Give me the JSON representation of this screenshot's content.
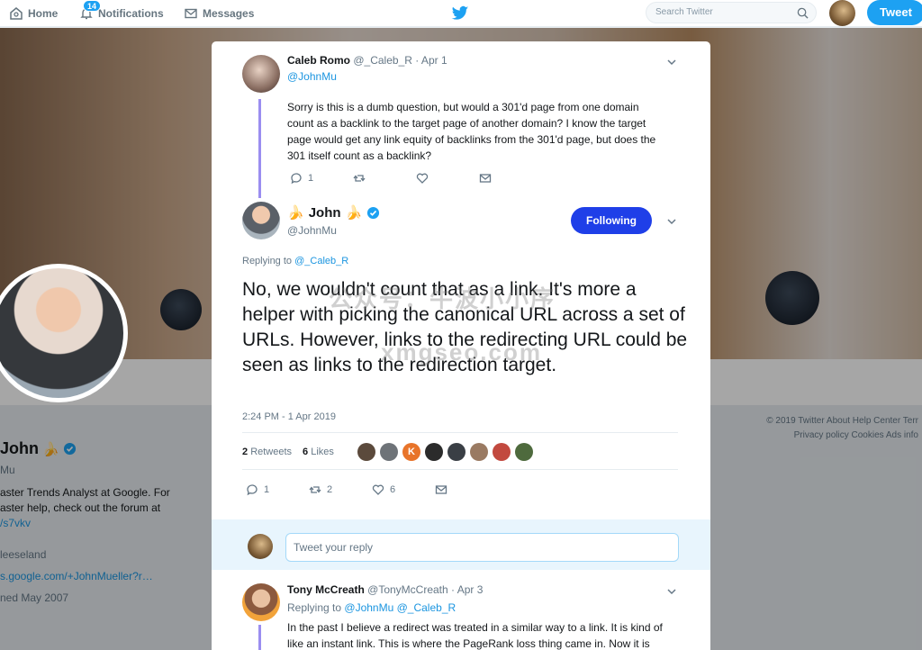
{
  "nav": {
    "home": "Home",
    "notifications": "Notifications",
    "notif_count": "14",
    "messages": "Messages",
    "search_placeholder": "Search Twitter",
    "tweet_button": "Tweet"
  },
  "profile": {
    "name": "John",
    "handle_partial": "Mu",
    "bio_line1": "aster Trends Analyst at Google. For",
    "bio_line2": "aster help, check out the forum at",
    "bio_link": "/s7vkv",
    "location": "leeseland",
    "website": "s.google.com/+JohnMueller?r…",
    "joined": "ned May 2007",
    "footer_line1": "© 2019 Twitter   About   Help Center   Terr",
    "footer_line2": "Privacy policy   Cookies   Ads info"
  },
  "parent_tweet": {
    "name": "Caleb Romo",
    "handle": "@_Caleb_R",
    "date": "· Apr 1",
    "reply_to": "@JohnMu",
    "text": "Sorry is this is a dumb question, but would a 301'd page from one domain count as a backlink to the target page of another domain? I know the target page would get any link equity of backlinks from the 301'd page, but does the 301 itself count as a backlink?",
    "replies": "1"
  },
  "main_tweet": {
    "name": "John",
    "emoji_left": "🍌",
    "emoji_right": "🍌",
    "handle": "@JohnMu",
    "follow_label": "Following",
    "replying_label": "Replying to",
    "replying_to": "@_Caleb_R",
    "text": "No, we wouldn't count that as a link. It's more a helper with picking the canonical URL across a set of URLs. However, links to the redirecting URL could be seen as links to the redirection target.",
    "timestamp": "2:24 PM - 1 Apr 2019",
    "retweets_count": "2",
    "retweets_label": "Retweets",
    "likes_count": "6",
    "likes_label": "Likes",
    "reply_count": "1",
    "retweet_count": "2",
    "like_count": "6"
  },
  "reply_box": {
    "placeholder": "Tweet your reply"
  },
  "next_tweet": {
    "name": "Tony McCreath",
    "handle": "@TonyMcCreath",
    "date": "· Apr 3",
    "replying_label": "Replying to",
    "replying_to_1": "@JohnMu",
    "replying_to_2": "@_Caleb_R",
    "text": "In the past I believe a redirect was treated in a similar way to a link. It is kind of like an instant link. This is where the PageRank loss thing came in. Now it is"
  },
  "watermark": {
    "line1": "公众号：牛波小小序",
    "line2": "xmgseo.com"
  },
  "colors": {
    "accent": "#1da1f2",
    "follow_button": "#1f3fe8",
    "thread_line": "#9b8ef0",
    "verified": "#1da1f2"
  }
}
